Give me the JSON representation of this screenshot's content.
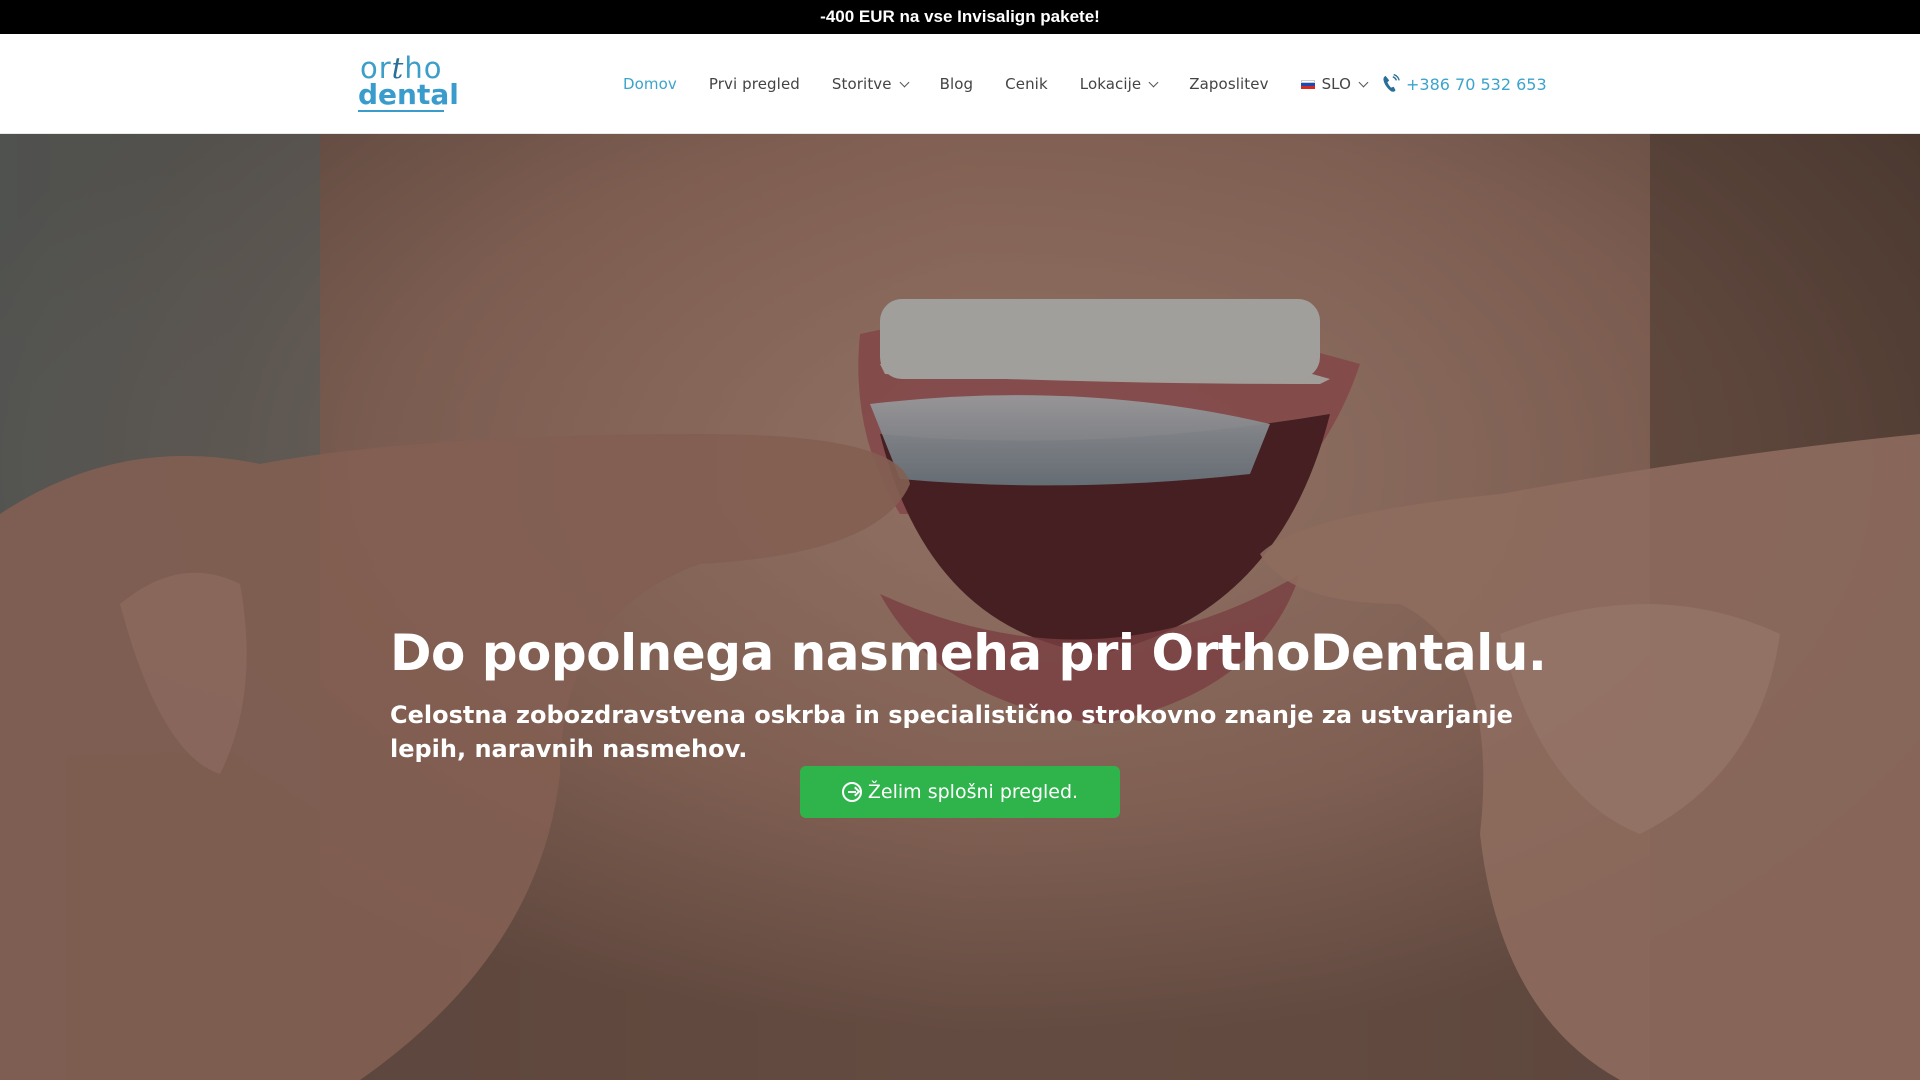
{
  "promo": {
    "text": "-400 EUR na vse Invisalign pakete!"
  },
  "header": {
    "logo": {
      "line1_start": "or",
      "line1_t": "t",
      "line1_end": "ho",
      "line2": "dental"
    },
    "nav": [
      {
        "label": "Domov",
        "active": true,
        "dropdown": false
      },
      {
        "label": "Prvi pregled",
        "active": false,
        "dropdown": false
      },
      {
        "label": "Storitve",
        "active": false,
        "dropdown": true
      },
      {
        "label": "Blog",
        "active": false,
        "dropdown": false
      },
      {
        "label": "Cenik",
        "active": false,
        "dropdown": false
      },
      {
        "label": "Lokacije",
        "active": false,
        "dropdown": true
      },
      {
        "label": "Zaposlitev",
        "active": false,
        "dropdown": false
      }
    ],
    "language": {
      "label": "SLO",
      "icon": "slovenia-flag-icon"
    },
    "phone": {
      "number": "+386 70 532 653",
      "icon": "phone-icon"
    }
  },
  "hero": {
    "title": "Do popolnega nasmeha pri OrthoDentalu.",
    "subtitle": "Celostna zobozdravstvena oskrba in specialistično strokovno znanje za ustvarjanje lepih, naravnih nasmehov.",
    "cta": {
      "label": "Želim splošni pregled.",
      "icon": "arrow-circle-right-icon"
    }
  },
  "colors": {
    "accent": "#3ba4cc",
    "promo_bg": "#000000",
    "cta_bg": "#2fb44c",
    "nav_text": "#444444"
  }
}
